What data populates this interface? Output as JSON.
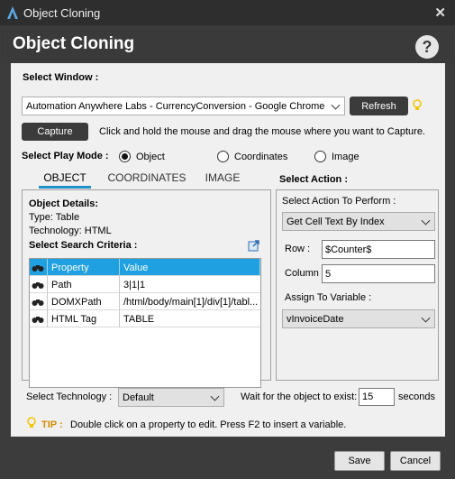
{
  "window": {
    "title": "Object Cloning",
    "close_glyph": "✕"
  },
  "header": {
    "title": "Object Cloning",
    "help_glyph": "?"
  },
  "select_window": {
    "label": "Select Window :",
    "value": "Automation Anywhere Labs - CurrencyConversion - Google Chrome",
    "refresh_label": "Refresh"
  },
  "capture": {
    "button_label": "Capture",
    "hint": "Click and hold the mouse and drag the mouse where you want to Capture."
  },
  "play_mode": {
    "label": "Select Play Mode :",
    "options": [
      "Object",
      "Coordinates",
      "Image"
    ],
    "selected": "Object"
  },
  "tabs": [
    "OBJECT",
    "COORDINATES",
    "IMAGE"
  ],
  "object_details": {
    "heading": "Object Details:",
    "type_line": "Type:  Table",
    "technology_line": "Technology:  HTML"
  },
  "search_criteria": {
    "heading": "Select Search Criteria :",
    "columns": [
      "Property",
      "Value"
    ],
    "rows": [
      {
        "property": "Path",
        "value": "3|1|1"
      },
      {
        "property": "DOMXPath",
        "value": "/html/body/main[1]/div[1]/tabl..."
      },
      {
        "property": "HTML Tag",
        "value": "TABLE"
      }
    ]
  },
  "action": {
    "heading": "Select Action :",
    "perform_label": "Select Action To Perform :",
    "perform_value": "Get Cell Text By Index",
    "row_label": "Row :",
    "row_value": "$Counter$",
    "column_label": "Column :",
    "column_value": "5",
    "assign_label": "Assign To Variable :",
    "assign_value": "vInvoiceDate"
  },
  "technology": {
    "label": "Select Technology :",
    "value": "Default"
  },
  "wait": {
    "label": "Wait for the object to exist:",
    "value": "15",
    "unit": "seconds"
  },
  "tip": {
    "label": "TIP :",
    "text": "Double click on a property to edit. Press F2 to insert a variable."
  },
  "footer": {
    "save_label": "Save",
    "cancel_label": "Cancel"
  },
  "colors": {
    "accent": "#1fa0e0",
    "tip_label": "#d08a00",
    "bulb": "#f5c400",
    "dark": "#3b3b3b"
  },
  "icons": [
    "app-logo-icon",
    "close-icon",
    "help-icon",
    "lightbulb-icon",
    "chevron-down-icon",
    "binoculars-icon",
    "export-icon"
  ]
}
